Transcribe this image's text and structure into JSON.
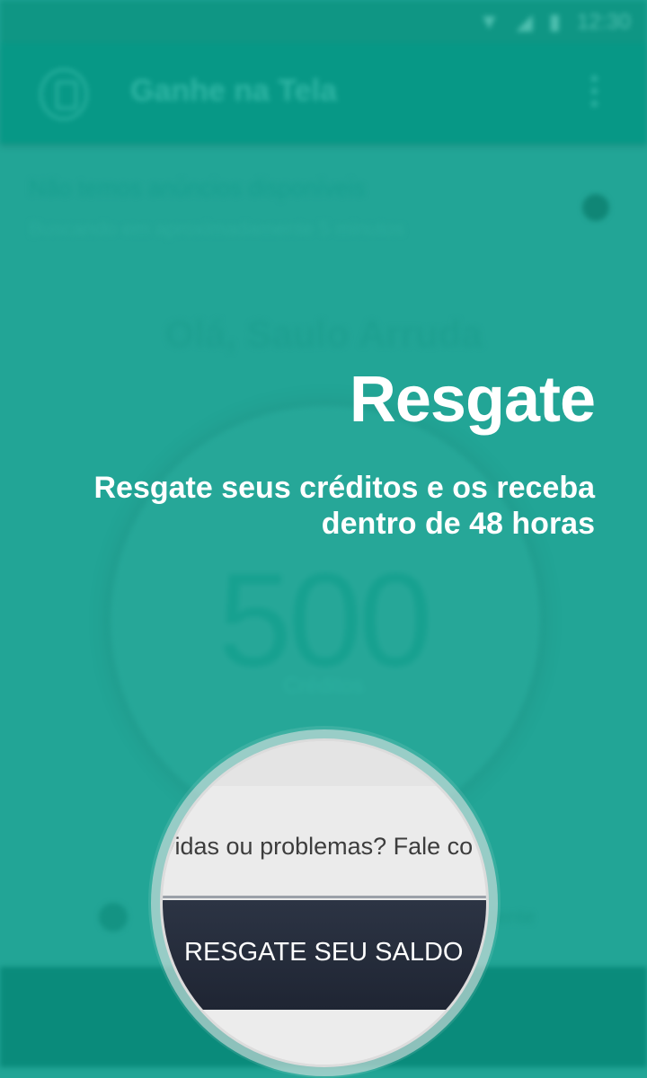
{
  "status_bar": {
    "time": "12:30",
    "icons": [
      "wifi-icon",
      "signal-icon",
      "battery-icon"
    ]
  },
  "app_bar": {
    "title": "Ganhe na Tela",
    "icons": [
      "app-logo-icon",
      "overflow-menu-icon"
    ]
  },
  "ads": {
    "title": "Não temos anúncios disponíveis",
    "subtitle": "Buscando em aproximadamente 5 minutos"
  },
  "greeting": "Olá, Saulo Arruda",
  "balance": {
    "value": "500",
    "label": "Créditos"
  },
  "contact": {
    "text": "vidas ou problemas? Fale co",
    "tail": "gente"
  },
  "overlay": {
    "title": "Resgate",
    "description": "Resgate seus créditos e os receba dentro de 48 horas"
  },
  "redeem_button": {
    "label": "RESGATE SEU SALDO"
  },
  "colors": {
    "background": "#22a596",
    "app_bar": "#079886",
    "button": "#252c3b",
    "overlay_text": "#ffffff"
  }
}
